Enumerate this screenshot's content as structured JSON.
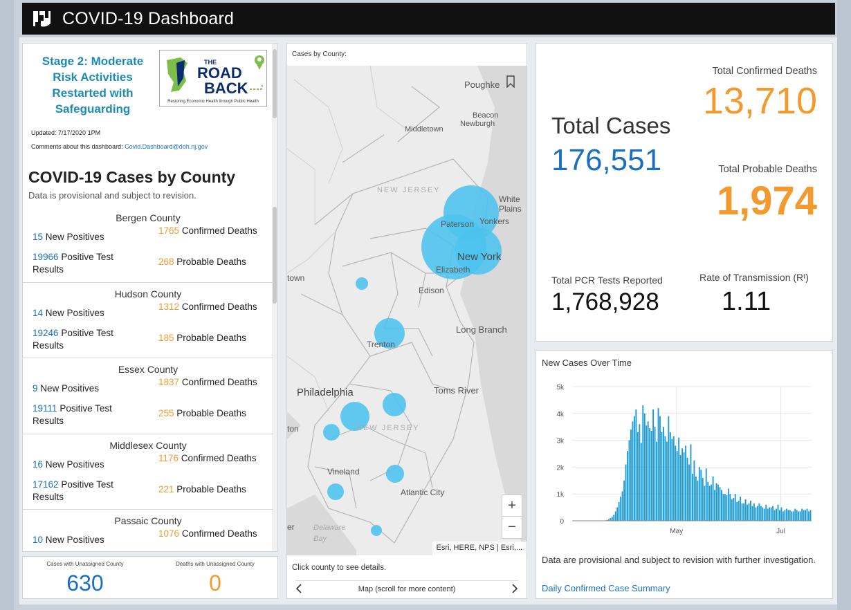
{
  "header": {
    "title": "COVID-19 Dashboard"
  },
  "left_panel": {
    "stage_text": "Stage 2: Moderate Risk Activities Restarted with Safeguarding",
    "logo": {
      "word_the": "THE",
      "word_road": "ROAD",
      "word_back": "BACK",
      "caption": "Restoring Economic Health through Public Health"
    },
    "updated": "Updated: 7/17/2020 1PM",
    "comments_label": "Comments about this dashboard:",
    "comments_email": "Covid.Dashboard@doh.nj.gov",
    "title": "COVID-19 Cases by County",
    "subtitle": "Data is provisional and subject to revision.",
    "labels": {
      "new_positives": "New Positives",
      "positive_tests": "Positive Test Results",
      "confirmed_deaths": "Confirmed Deaths",
      "probable_deaths": "Probable Deaths"
    },
    "counties": [
      {
        "name": "Bergen County",
        "new_positives": "15",
        "positive_tests": "19966",
        "confirmed_deaths": "1765",
        "probable_deaths": "268"
      },
      {
        "name": "Hudson County",
        "new_positives": "14",
        "positive_tests": "19246",
        "confirmed_deaths": "1312",
        "probable_deaths": "185"
      },
      {
        "name": "Essex County",
        "new_positives": "9",
        "positive_tests": "19111",
        "confirmed_deaths": "1837",
        "probable_deaths": "255"
      },
      {
        "name": "Middlesex County",
        "new_positives": "16",
        "positive_tests": "17162",
        "confirmed_deaths": "1176",
        "probable_deaths": "221"
      },
      {
        "name": "Passaic County",
        "new_positives": "10",
        "positive_tests": "",
        "confirmed_deaths": "1076",
        "probable_deaths": ""
      }
    ]
  },
  "unassigned": {
    "cases_label": "Cases with Unassigned County",
    "cases_value": "630",
    "deaths_label": "Deaths with Unassigned County",
    "deaths_value": "0"
  },
  "map": {
    "title": "Cases by County:",
    "labels": {
      "poughkeepsie": "Poughke",
      "beacon": "Beacon",
      "newburgh": "Newburgh",
      "middletown": "Middletown",
      "new_jersey_top": "NEW JERSEY",
      "white_plains": "White Plains",
      "paterson": "Paterson",
      "yonkers": "Yonkers",
      "new_york": "New York",
      "elizabeth": "Elizabeth",
      "town": "town",
      "edison": "Edison",
      "trenton": "Trenton",
      "long_branch": "Long Branch",
      "philadelphia": "Philadelphia",
      "toms_river": "Toms River",
      "new_jersey_bottom": "NEW JERSEY",
      "ton": "ton",
      "vineland": "Vineland",
      "atlantic_city": "Atlantic City",
      "er": "er",
      "delaware_bay": "Delaware Bay"
    },
    "zoom_in": "+",
    "zoom_out": "−",
    "attribution": "Esri, HERE, NPS | Esri,...",
    "footer": "Click county to see details.",
    "nav_text": "Map (scroll for more content)"
  },
  "totals": {
    "total_cases_label": "Total Cases",
    "total_cases_value": "176,551",
    "confirmed_deaths_label": "Total Confirmed Deaths",
    "confirmed_deaths_value": "13,710",
    "probable_deaths_label": "Total Probable Deaths",
    "probable_deaths_value": "1,974",
    "pcr_label": "Total PCR Tests Reported",
    "pcr_value": "1,768,928",
    "rt_label": "Rate of Transmission (Rᵗ)",
    "rt_value": "1.11"
  },
  "chart_panel": {
    "title": "New Cases Over Time",
    "note": "Data are provisional and subject to revision with further investigation.",
    "link": "Daily Confirmed Case Summary"
  },
  "chart_data": {
    "type": "bar",
    "title": "New Cases Over Time",
    "ylim": [
      0,
      5000
    ],
    "yticks": [
      0,
      1000,
      2000,
      3000,
      4000,
      5000
    ],
    "ytick_labels": [
      "0",
      "1k",
      "2k",
      "3k",
      "4k",
      "5k"
    ],
    "xtick_labels": [
      "May",
      "Jul"
    ],
    "x_start": "2020-03-01",
    "color": "#1a9bd7",
    "values": [
      0,
      0,
      0,
      0,
      0,
      0,
      0,
      0,
      0,
      0,
      0,
      0,
      0,
      0,
      0,
      0,
      0,
      5,
      10,
      15,
      30,
      60,
      100,
      150,
      220,
      350,
      500,
      700,
      900,
      1100,
      1500,
      2100,
      2600,
      3000,
      3400,
      3700,
      3900,
      4150,
      3300,
      3600,
      2900,
      4300,
      4000,
      3550,
      3700,
      3450,
      3350,
      4150,
      3500,
      2950,
      4200,
      3900,
      3300,
      3500,
      3150,
      2950,
      3900,
      3300,
      3050,
      3150,
      2800,
      2600,
      3100,
      2450,
      2700,
      2550,
      2800,
      2350,
      2100,
      2850,
      1750,
      2250,
      1650,
      1500,
      2000,
      1900,
      1600,
      1300,
      1950,
      1450,
      1300,
      1350,
      1650,
      1150,
      1400,
      1350,
      1250,
      1150,
      1000,
      1000,
      950,
      1200,
      1000,
      800,
      850,
      1000,
      700,
      750,
      900,
      650,
      650,
      800,
      600,
      650,
      750,
      550,
      650,
      500,
      550,
      650,
      550,
      500,
      450,
      600,
      450,
      500,
      500,
      550,
      400,
      450,
      600,
      400,
      500,
      350,
      400,
      450,
      400,
      400,
      350,
      350,
      450,
      400,
      350,
      350,
      450,
      400,
      400,
      450,
      350,
      400
    ]
  }
}
